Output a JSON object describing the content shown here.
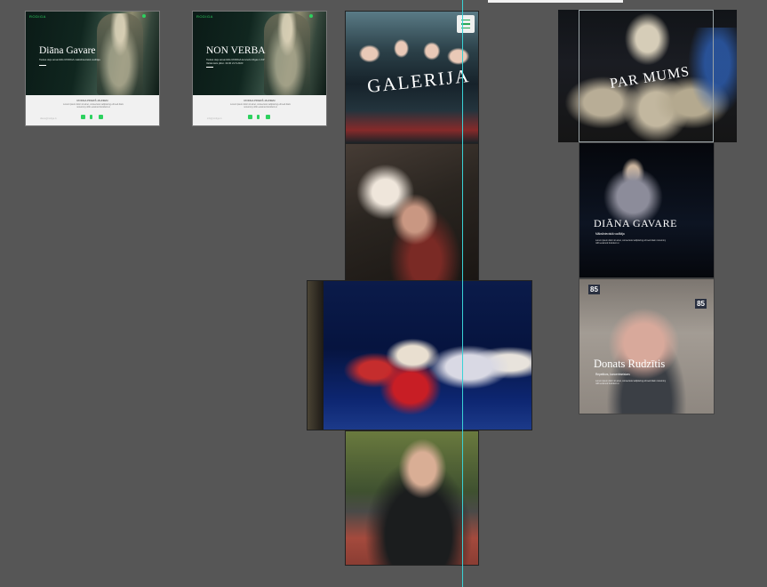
{
  "cards": [
    {
      "logo": "RODIGA",
      "title": "Diāna Gavare",
      "desc": "Tautas deju ansamblis RODIGA mākslinieciskā vadītāja",
      "foot_title": "RODIGA PRIEKŠ JAUNIEM",
      "foot_text": "Lorem ipsum dolor sit amet, consectetur adipiscing elit sed diam nonummy nibh euismod tincidunt ut",
      "foot_link": "diana@rodiga.lv"
    },
    {
      "logo": "RODIGA",
      "title": "NON VERBA",
      "desc": "Tautas deju ansamblis RODIGA koncerts Rīgas 1.KP Valdemārs plkst. 19.00 21.5.2023",
      "foot_title": "RODIGA PRIEKŠ JAUNIEM",
      "foot_text": "Lorem ipsum dolor sit amet, consectetur adipiscing elit sed diam nonummy nibh euismod tincidunt ut",
      "foot_link": "info@rodiga.lv"
    }
  ],
  "tiles": {
    "galerija": {
      "caption": "GALERIJA"
    },
    "par_mums": {
      "caption": "PAR MUMS"
    },
    "diana": {
      "caption": "DIĀNA GAVARE",
      "sub": "Mākslinieciskā vadītāja",
      "text": "Lorem ipsum dolor sit amet, consectetur adipiscing elit sed diam nonummy nibh euismod tincidunt ut"
    },
    "donats": {
      "caption": "Donats Rudzītis",
      "sub": "Repetitors, koncertmeistars",
      "text": "Lorem ipsum dolor sit amet, consectetur adipiscing elit sed diam nonummy nibh euismod tincidunt ut",
      "house_number_left": "85",
      "house_number_right": "85"
    }
  },
  "colors": {
    "canvas": "#565656",
    "brand_green": "#2dd15f",
    "guide": "#39d2d6"
  },
  "icons": [
    "menu-icon",
    "shield-icon",
    "facebook-icon",
    "mail-icon"
  ]
}
